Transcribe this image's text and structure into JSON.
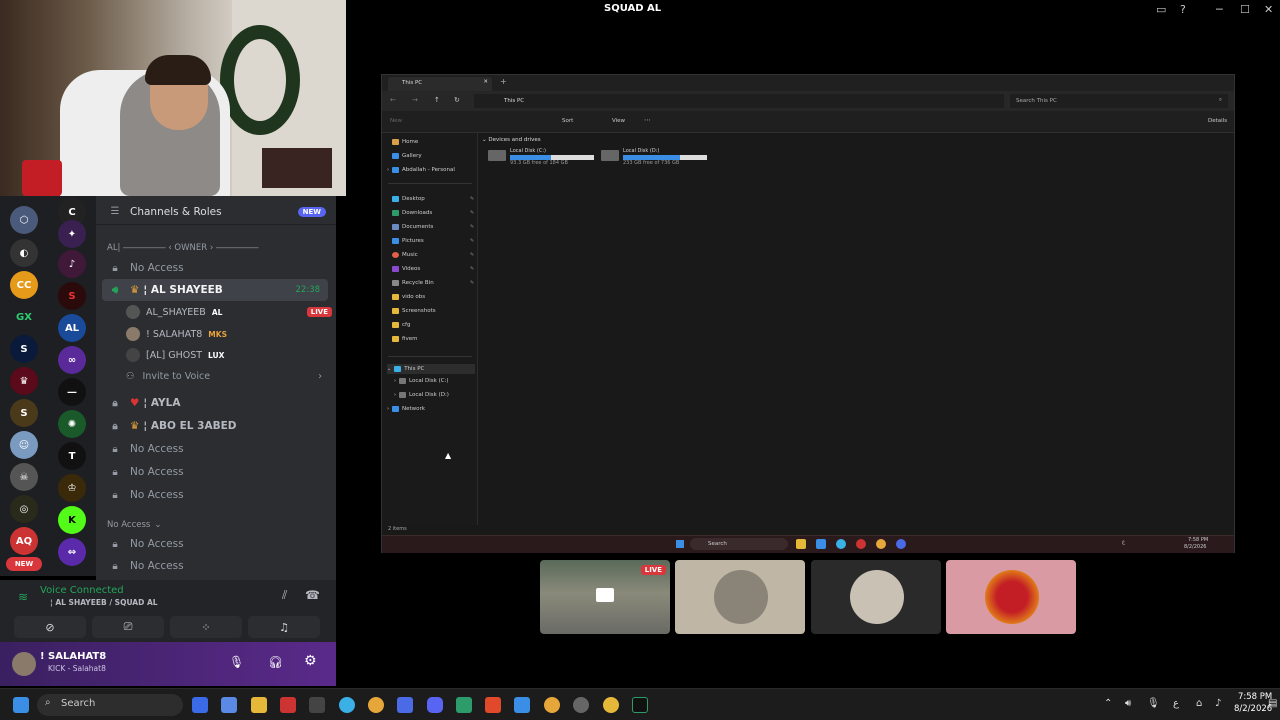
{
  "window_title": "SQUAD AL",
  "channels_header": {
    "label": "Channels & Roles",
    "badge": "NEW"
  },
  "category_owner": "AL| ――――― ‹ OWNER › ―――――",
  "channels": {
    "c1": "No Access",
    "active": "¦ AL SHAYEEB",
    "active_time": "22:38",
    "ayla": "¦ AYLA",
    "abo": "¦ ABO EL 3ABED",
    "c5": "No Access",
    "c6": "No Access",
    "c7": "No Access",
    "cat2": "No Access",
    "c8": "No Access",
    "c9": "No Access"
  },
  "voice_users": [
    {
      "name": "AL_SHAYEEB",
      "tag": "AL",
      "live": "LIVE"
    },
    {
      "name": "! SALAHAT8",
      "tag": "MKS"
    },
    {
      "name": "[AL] GHOST",
      "tag": "LUX"
    }
  ],
  "invite": "Invite to Voice",
  "voice_panel": {
    "status": "Voice Connected",
    "channel": "¦ AL SHAYEEB / SQUAD AL"
  },
  "user_panel": {
    "name": "! SALAHAT8",
    "sub": "KICK - Salahat8"
  },
  "rail_badge": "NEW",
  "explorer": {
    "tab": "This PC",
    "path": "This PC",
    "search": "Search This PC",
    "toolbar": {
      "new": "New",
      "sort": "Sort",
      "view": "View",
      "details": "Details"
    },
    "section": "Devices and drives",
    "drives": [
      {
        "name": "Local Disk (C:)",
        "free": "93.3 GB free of 184 GB",
        "used_fraction": 0.49
      },
      {
        "name": "Local Disk (D:)",
        "free": "233 GB free of 736 GB",
        "used_fraction": 0.68
      }
    ],
    "nav": [
      "Home",
      "Gallery",
      "Abdallah - Personal",
      "Desktop",
      "Downloads",
      "Documents",
      "Pictures",
      "Music",
      "Videos",
      "Recycle Bin",
      "vido obs",
      "Screenshots",
      "cfg",
      "fivem",
      "This PC",
      "Local Disk (C:)",
      "Local Disk (D:)",
      "Network"
    ],
    "status": "2 items",
    "taskbar_search": "Search",
    "clock_time": "7:58 PM",
    "clock_date": "8/2/2026"
  },
  "tile_live": "LIVE",
  "taskbar": {
    "search": "Search",
    "time": "7:58 PM",
    "date": "8/2/2026",
    "lang": "ع"
  }
}
